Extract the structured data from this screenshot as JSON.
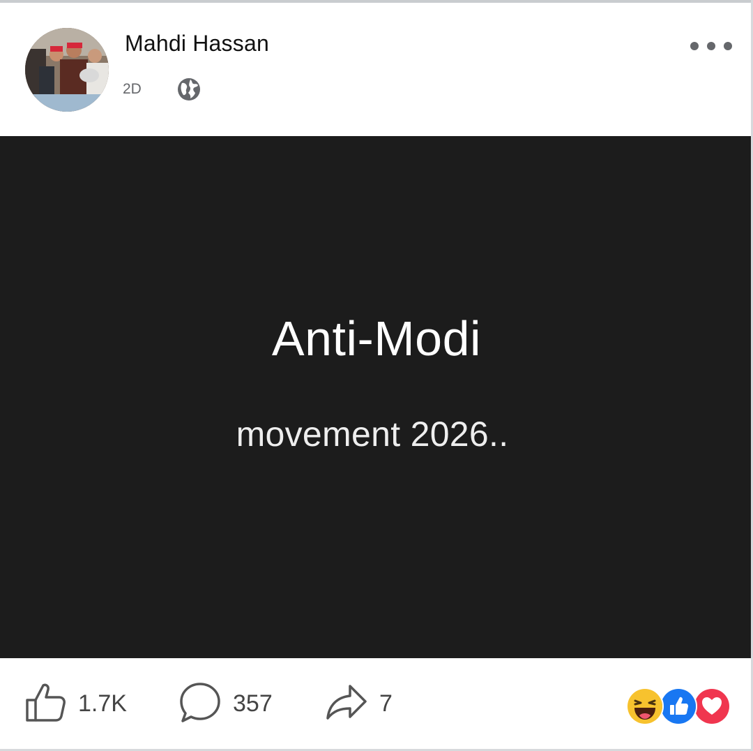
{
  "post": {
    "author_name": "Mahdi Hassan",
    "time": "2D",
    "privacy_icon": "globe-icon",
    "more_icon": "more-options-icon",
    "media": {
      "line1": "Anti-Modi",
      "line2": "movement 2026..",
      "background": "#1c1c1c"
    },
    "stats": {
      "likes": "1.7K",
      "comments": "357",
      "shares": "7"
    },
    "reactions": [
      "haha-reaction-icon",
      "like-reaction-icon",
      "love-reaction-icon"
    ]
  }
}
